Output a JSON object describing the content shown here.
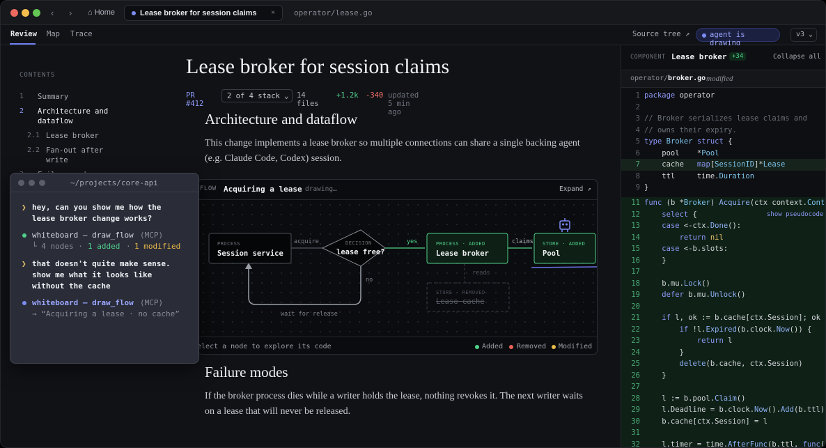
{
  "titlebar": {
    "home_label": "⌂ Home",
    "active_tab": "Lease broker for session claims",
    "close_glyph": "×",
    "path": "operator/lease.go"
  },
  "toolbar": {
    "tabs": [
      "Review",
      "Map",
      "Trace"
    ],
    "source_tree": "Source tree ↗",
    "agent_status": "agent is drawing",
    "version": "v3 ⌄"
  },
  "toc": {
    "heading": "CONTENTS",
    "items": [
      {
        "num": "1",
        "label": "Summary"
      },
      {
        "num": "2",
        "label": "Architecture and dataflow"
      },
      {
        "num": "2.1",
        "label": "Lease broker"
      },
      {
        "num": "2.2",
        "label": "Fan-out after write"
      },
      {
        "num": "3",
        "label": "Failure modes"
      }
    ]
  },
  "doc": {
    "title": "Lease broker for session claims",
    "pr": "PR #412",
    "stack": "2 of 4 stack ⌄",
    "files": "14 files",
    "added": "+1.2k",
    "removed": "-340",
    "updated": "updated 5 min ago",
    "section1_title": "Architecture and dataflow",
    "section1_body": "This change implements a lease broker so multiple connections can share a single backing agent (e.g. Claude Code, Codex) session.",
    "section2_title": "Failure modes",
    "section2_body": "If the broker process dies while a writer holds the lease, nothing revokes it. The next writer waits on a lease that will never be released."
  },
  "diagram": {
    "tag": "FLOW",
    "title": "Acquiring a lease",
    "status": "drawing…",
    "expand": "Expand ↗",
    "nodes": {
      "session": {
        "kind": "PROCESS",
        "label": "Session service"
      },
      "decision": {
        "kind": "DECISION",
        "label": "lease free?"
      },
      "broker": {
        "kind": "PROCESS · ADDED",
        "label": "Lease broker"
      },
      "pool": {
        "kind": "STORE · ADDED",
        "label": "Pool"
      },
      "cache": {
        "kind": "STORE · REMOVED",
        "label": "Lease cache"
      }
    },
    "edges": {
      "acquire": "acquire",
      "yes": "yes",
      "claims": "claims",
      "reads": "reads",
      "no": "no",
      "wait": "wait for release"
    },
    "footer_hint": "Select a node to explore its code",
    "legend": [
      {
        "label": "Added",
        "color": "#4fd18b"
      },
      {
        "label": "Removed",
        "color": "#e8625a"
      },
      {
        "label": "Modified",
        "color": "#e9b949"
      }
    ]
  },
  "code": {
    "component_label": "COMPONENT",
    "component_name": "Lease broker",
    "badge": "+34",
    "collapse": "Collapse all",
    "file_dir": "operator/",
    "file_name": "broker.go",
    "file_status": "modified",
    "pseudocode_link": "show pseudocode",
    "lines": [
      {
        "n": "1",
        "t": "package operator",
        "s": ""
      },
      {
        "n": "2",
        "t": "",
        "s": ""
      },
      {
        "n": "3",
        "t": "// Broker serializes lease claims and",
        "s": ""
      },
      {
        "n": "4",
        "t": "// owns their expiry.",
        "s": ""
      },
      {
        "n": "5",
        "t": "type Broker struct {",
        "s": ""
      },
      {
        "n": "6",
        "t": "    pool    *Pool",
        "s": ""
      },
      {
        "n": "7",
        "t": "    cache   map[SessionID]*Lease",
        "s": "mod"
      },
      {
        "n": "8",
        "t": "    ttl     time.Duration",
        "s": ""
      },
      {
        "n": "9",
        "t": "}",
        "s": ""
      },
      {
        "n": "11",
        "t": "func (b *Broker) Acquire(ctx context.Context",
        "s": "add"
      },
      {
        "n": "12",
        "t": "    select {",
        "s": "add"
      },
      {
        "n": "13",
        "t": "    case <-ctx.Done():",
        "s": "add"
      },
      {
        "n": "14",
        "t": "        return nil",
        "s": "add"
      },
      {
        "n": "15",
        "t": "    case <-b.slots:",
        "s": "add"
      },
      {
        "n": "16",
        "t": "    }",
        "s": "add"
      },
      {
        "n": "17",
        "t": "",
        "s": "add"
      },
      {
        "n": "18",
        "t": "    b.mu.Lock()",
        "s": "add"
      },
      {
        "n": "19",
        "t": "    defer b.mu.Unlock()",
        "s": "add"
      },
      {
        "n": "20",
        "t": "",
        "s": "add"
      },
      {
        "n": "21",
        "t": "    if l, ok := b.cache[ctx.Session]; ok {",
        "s": "add"
      },
      {
        "n": "22",
        "t": "        if !l.Expired(b.clock.Now()) {",
        "s": "add"
      },
      {
        "n": "23",
        "t": "            return l",
        "s": "add"
      },
      {
        "n": "24",
        "t": "        }",
        "s": "add"
      },
      {
        "n": "25",
        "t": "        delete(b.cache, ctx.Session)",
        "s": "add"
      },
      {
        "n": "26",
        "t": "    }",
        "s": "add"
      },
      {
        "n": "27",
        "t": "",
        "s": "add"
      },
      {
        "n": "28",
        "t": "    l := b.pool.Claim()",
        "s": "add"
      },
      {
        "n": "29",
        "t": "    l.Deadline = b.clock.Now().Add(b.ttl)",
        "s": "add"
      },
      {
        "n": "30",
        "t": "    b.cache[ctx.Session] = l",
        "s": "add"
      },
      {
        "n": "31",
        "t": "",
        "s": "add"
      },
      {
        "n": "32",
        "t": "    l.timer = time.AfterFunc(b.ttl, func() {",
        "s": "add"
      }
    ]
  },
  "terminal": {
    "title": "~/projects/core-api",
    "prompt_glyph": "❯",
    "msg1_line1": "hey, can you show me how the",
    "msg1_line2": "lease broker change works?",
    "tool1_name": "whiteboard — draw_flow",
    "tool1_tag": "(MCP)",
    "tool1_result_prefix": "└ 4 nodes ·",
    "tool1_added": "1 added",
    "tool1_sep": "·",
    "tool1_modified": "1 modified",
    "msg2_line1": "that doesn't quite make sense.",
    "msg2_line2": "show me what it looks like",
    "msg2_line3": "without the cache",
    "tool2_name": "whiteboard — draw_flow",
    "tool2_tag": "(MCP)",
    "tool2_result": "→ “Acquiring a lease · no cache”"
  }
}
